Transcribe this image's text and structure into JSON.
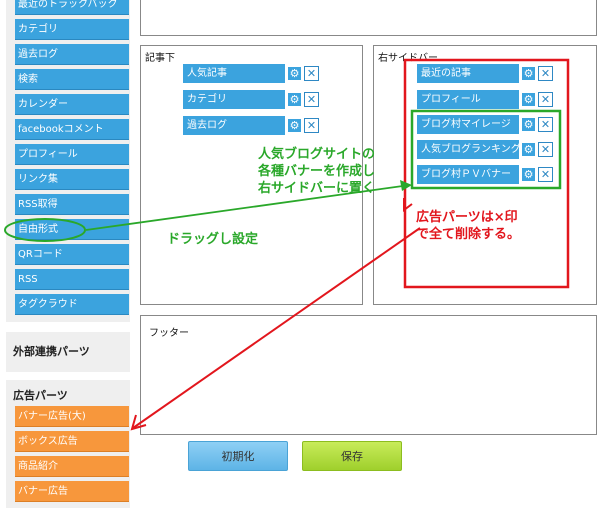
{
  "sidebar": {
    "parts": [
      {
        "label": "最近のトラックバック"
      },
      {
        "label": "カテゴリ"
      },
      {
        "label": "過去ログ"
      },
      {
        "label": "検索"
      },
      {
        "label": "カレンダー"
      },
      {
        "label": "facebookコメント"
      },
      {
        "label": "プロフィール"
      },
      {
        "label": "リンク集"
      },
      {
        "label": "RSS取得"
      },
      {
        "label": "自由形式"
      },
      {
        "label": "QRコード"
      },
      {
        "label": "RSS"
      },
      {
        "label": "タグクラウド"
      }
    ],
    "external_title": "外部連携パーツ",
    "ads_title": "広告パーツ",
    "ads": [
      {
        "label": "バナー広告(大)"
      },
      {
        "label": "ボックス広告"
      },
      {
        "label": "商品紹介"
      },
      {
        "label": "バナー広告"
      }
    ]
  },
  "layout": {
    "under_article": {
      "label": "記事下",
      "widgets": [
        {
          "label": "人気記事"
        },
        {
          "label": "カテゴリ"
        },
        {
          "label": "過去ログ"
        }
      ]
    },
    "right_sidebar": {
      "label": "右サイドバー",
      "widgets": [
        {
          "label": "最近の記事"
        },
        {
          "label": "プロフィール"
        },
        {
          "label": "ブログ村マイレージ"
        },
        {
          "label": "人気ブログランキング"
        },
        {
          "label": "ブログ村ＰＶバナー"
        }
      ]
    },
    "footer": {
      "label": "フッター"
    }
  },
  "icons": {
    "gear": "⚙",
    "close": "✕"
  },
  "buttons": {
    "reset": "初期化",
    "save": "保存"
  },
  "annotations": {
    "green_note": [
      "人気ブログサイトの",
      "各種バナーを作成し",
      "右サイドバーに置く"
    ],
    "drag_note": "ドラッグし設定",
    "red_note": [
      "広告パーツは×印",
      "で全て削除する。"
    ]
  },
  "colors": {
    "accent": "#3ba3de",
    "ad": "#f7973c",
    "annotation_green": "#2aa82a",
    "annotation_red": "#e2161d"
  }
}
